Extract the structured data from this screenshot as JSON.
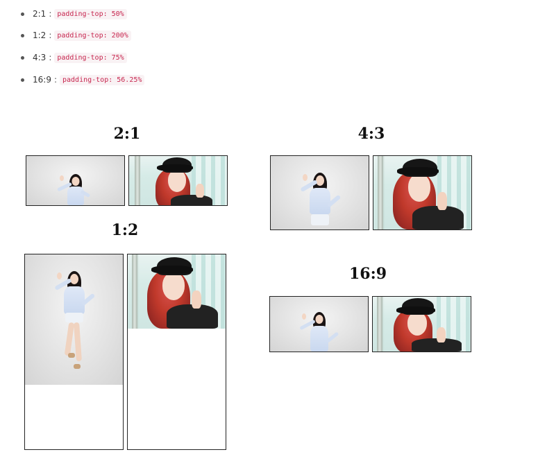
{
  "ratios": [
    {
      "label": "2:1",
      "sep": ":",
      "code": "padding-top: 50%"
    },
    {
      "label": "1:2",
      "sep": ":",
      "code": "padding-top: 200%"
    },
    {
      "label": "4:3",
      "sep": ":",
      "code": "padding-top: 75%"
    },
    {
      "label": "16:9",
      "sep": ":",
      "code": "padding-top: 56.25%"
    }
  ],
  "demos": {
    "ratio_2_1": {
      "title": "2:1"
    },
    "ratio_1_2": {
      "title": "1:2"
    },
    "ratio_4_3": {
      "title": "4:3"
    },
    "ratio_16_9": {
      "title": "16:9"
    }
  },
  "colors": {
    "code_text": "#c7254e",
    "code_bg": "#f9f2f4",
    "frame_border": "#222222",
    "hair_red": "#c0392b",
    "cap_black": "#161616",
    "shirt_blue": "#c9d8ef"
  }
}
